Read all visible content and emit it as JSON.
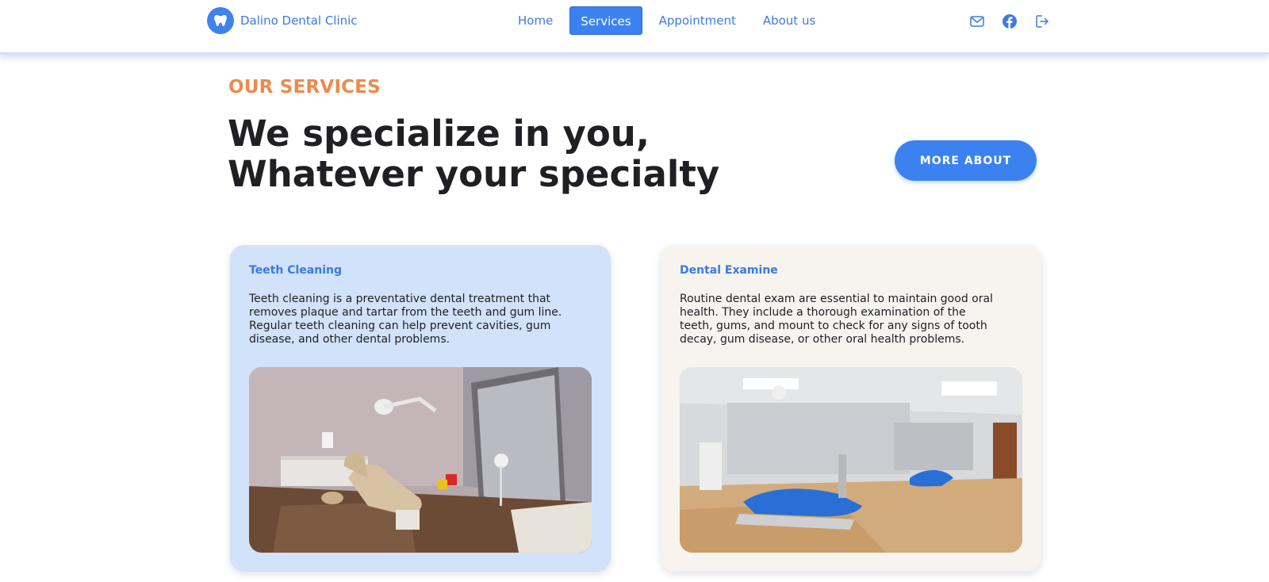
{
  "header": {
    "brand_name": "Dalino Dental Clinic",
    "brand_icon": "tooth-icon",
    "nav": [
      {
        "label": "Home",
        "active": false
      },
      {
        "label": "Services",
        "active": true
      },
      {
        "label": "Appointment",
        "active": false
      },
      {
        "label": "About us",
        "active": false
      }
    ],
    "icons": [
      "mail-icon",
      "facebook-icon",
      "logout-icon"
    ],
    "accent_color": "#3b82f0"
  },
  "section": {
    "eyebrow": "OUR SERVICES",
    "headline_line1": "We specialize in you,",
    "headline_line2": "Whatever your specialty",
    "more_button": "MORE ABOUT"
  },
  "cards": [
    {
      "title": "Teeth Cleaning",
      "text": "Teeth cleaning is a preventative dental treatment that removes plaque and tartar from the teeth and gum line. Regular teeth cleaning can help prevent cavities, gum disease, and other dental problems.",
      "background": "#d1e2fa"
    },
    {
      "title": "Dental Examine",
      "text": "Routine dental exam are essential to maintain good oral health. They include a thorough examination of the teeth, gums, and mount to check for any signs of tooth decay, gum disease, or other oral health problems.",
      "background": "#f7f3ee"
    }
  ],
  "colors": {
    "eyebrow": "#ed8a4b",
    "nav_text": "#3f7be0",
    "heading": "#1f1f24"
  }
}
